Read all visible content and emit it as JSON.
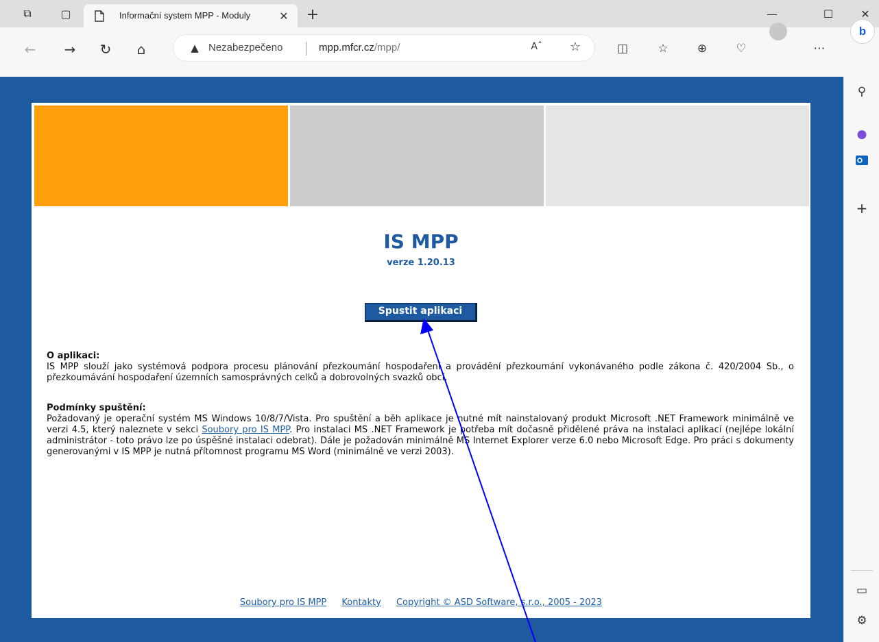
{
  "browser": {
    "tab_title": "Informační system MPP - Moduly",
    "insecure_label": "Nezabezpečeno",
    "url_host": "mpp.mfcr.cz",
    "url_path": "/mpp/",
    "read_aloud": "Aˆ"
  },
  "page": {
    "app_title": "IS MPP",
    "version": "verze 1.20.13",
    "run_button": "Spustit aplikaci",
    "about_heading": "O aplikaci:",
    "about_text": "IS MPP slouží jako systémová podpora procesu plánování přezkoumání hospodaření a provádění přezkoumání vykonávaného podle zákona č. 420/2004 Sb., o přezkoumávání hospodaření územních samosprávných celků a dobrovolných svazků obcí.",
    "req_heading": "Podmínky spuštění:",
    "req_text_1": "Požadovaný je operační systém MS Windows 10/8/7/Vista. Pro spuštění a běh aplikace je nutné mít nainstalovaný produkt Microsoft .NET Framework minimálně ve verzi 4.5, který naleznete v sekci ",
    "req_link": "Soubory pro IS MPP",
    "req_text_2": ". Pro instalaci MS .NET Framework je potřeba mít dočasně přidělené práva na instalaci aplikací (nejlépe lokální administrátor - toto právo lze po úspěšné instalaci odebrat). Dále je požadován minimálně MS Internet Explorer verze 6.0 nebo Microsoft Edge. Pro práci s dokumenty generovanými v IS MPP je nutná přítomnost programu MS Word (minimálně ve verzi 2003).",
    "footer": {
      "files": "Soubory pro IS MPP",
      "contacts": "Kontakty",
      "copyright": "Copyright © ASD Software, s.r.o., 2005 - 2023"
    }
  },
  "colors": {
    "page_bg": "#1e5aa0",
    "orange_block": "#ffa00a",
    "gray_block": "#cbcbcb",
    "light_block": "#e5e5e5",
    "annotation_arrow": "#0000ff"
  }
}
